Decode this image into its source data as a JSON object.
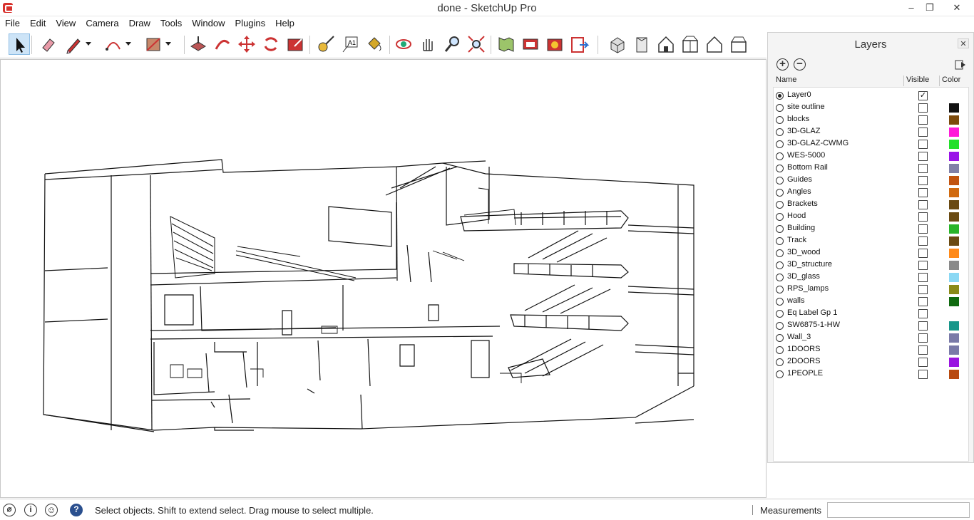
{
  "window": {
    "title": "done - SketchUp Pro",
    "minimize": "–",
    "restore": "❐",
    "close": "✕"
  },
  "menu": [
    "File",
    "Edit",
    "View",
    "Camera",
    "Draw",
    "Tools",
    "Window",
    "Plugins",
    "Help"
  ],
  "toolbar": {
    "tools": [
      {
        "name": "select-icon",
        "active": true
      },
      {
        "name": "eraser-icon"
      },
      {
        "name": "pencil-icon",
        "dropdown": true
      },
      {
        "name": "arc-icon",
        "dropdown": true
      },
      {
        "name": "rectangle-icon",
        "dropdown": true
      },
      {
        "name": "push-pull-icon"
      },
      {
        "name": "follow-me-icon"
      },
      {
        "name": "move-icon"
      },
      {
        "name": "rotate-icon"
      },
      {
        "name": "scale-icon"
      },
      {
        "name": "tape-measure-icon"
      },
      {
        "name": "text-icon"
      },
      {
        "name": "paint-bucket-icon"
      },
      {
        "name": "orbit-icon"
      },
      {
        "name": "pan-icon"
      },
      {
        "name": "zoom-icon"
      },
      {
        "name": "zoom-extents-icon"
      },
      {
        "name": "map-icon"
      },
      {
        "name": "warehouse-icon"
      },
      {
        "name": "extension-icon"
      },
      {
        "name": "share-icon"
      },
      {
        "name": "iso-view-icon"
      },
      {
        "name": "top-view-icon"
      },
      {
        "name": "front-view-icon"
      },
      {
        "name": "right-view-icon"
      },
      {
        "name": "back-view-icon"
      },
      {
        "name": "left-view-icon"
      }
    ]
  },
  "layers": {
    "title": "Layers",
    "close": "✕",
    "col_name": "Name",
    "col_visible": "Visible",
    "col_color": "Color",
    "items": [
      {
        "name": "Layer0",
        "active": true,
        "visible": true,
        "color": ""
      },
      {
        "name": "site outline",
        "active": false,
        "visible": false,
        "color": "#111111"
      },
      {
        "name": "blocks",
        "active": false,
        "visible": false,
        "color": "#7b4a0c"
      },
      {
        "name": "3D-GLAZ",
        "active": false,
        "visible": false,
        "color": "#ff1ad9"
      },
      {
        "name": "3D-GLAZ-CWMG",
        "active": false,
        "visible": false,
        "color": "#22e02a"
      },
      {
        "name": "WES-5000",
        "active": false,
        "visible": false,
        "color": "#9a12e8"
      },
      {
        "name": "Bottom Rail",
        "active": false,
        "visible": false,
        "color": "#8080a8"
      },
      {
        "name": "Guides",
        "active": false,
        "visible": false,
        "color": "#c25410"
      },
      {
        "name": "Angles",
        "active": false,
        "visible": false,
        "color": "#d06a10"
      },
      {
        "name": "Brackets",
        "active": false,
        "visible": false,
        "color": "#6a4a12"
      },
      {
        "name": "Hood",
        "active": false,
        "visible": false,
        "color": "#6a4a12"
      },
      {
        "name": "Building",
        "active": false,
        "visible": false,
        "color": "#28b428"
      },
      {
        "name": "Track",
        "active": false,
        "visible": false,
        "color": "#6a4a12"
      },
      {
        "name": "3D_wood",
        "active": false,
        "visible": false,
        "color": "#ff8a1a"
      },
      {
        "name": "3D_structure",
        "active": false,
        "visible": false,
        "color": "#8a8a8a"
      },
      {
        "name": "3D_glass",
        "active": false,
        "visible": false,
        "color": "#8ad8f4"
      },
      {
        "name": "RPS_lamps",
        "active": false,
        "visible": false,
        "color": "#8a8a18"
      },
      {
        "name": "walls",
        "active": false,
        "visible": false,
        "color": "#106a10"
      },
      {
        "name": "Eq Label Gp 1",
        "active": false,
        "visible": false,
        "color": ""
      },
      {
        "name": "SW6875-1-HW",
        "active": false,
        "visible": false,
        "color": "#18968a"
      },
      {
        "name": "Wall_3",
        "active": false,
        "visible": false,
        "color": "#7a7aa8"
      },
      {
        "name": "1DOORS",
        "active": false,
        "visible": false,
        "color": "#7a7aa8"
      },
      {
        "name": "2DOORS",
        "active": false,
        "visible": false,
        "color": "#9a14e0"
      },
      {
        "name": "1PEOPLE",
        "active": false,
        "visible": false,
        "color": "#b84a10"
      }
    ]
  },
  "status": {
    "message": "Select objects. Shift to extend select. Drag mouse to select multiple.",
    "measurements_label": "Measurements",
    "measurements_value": ""
  }
}
